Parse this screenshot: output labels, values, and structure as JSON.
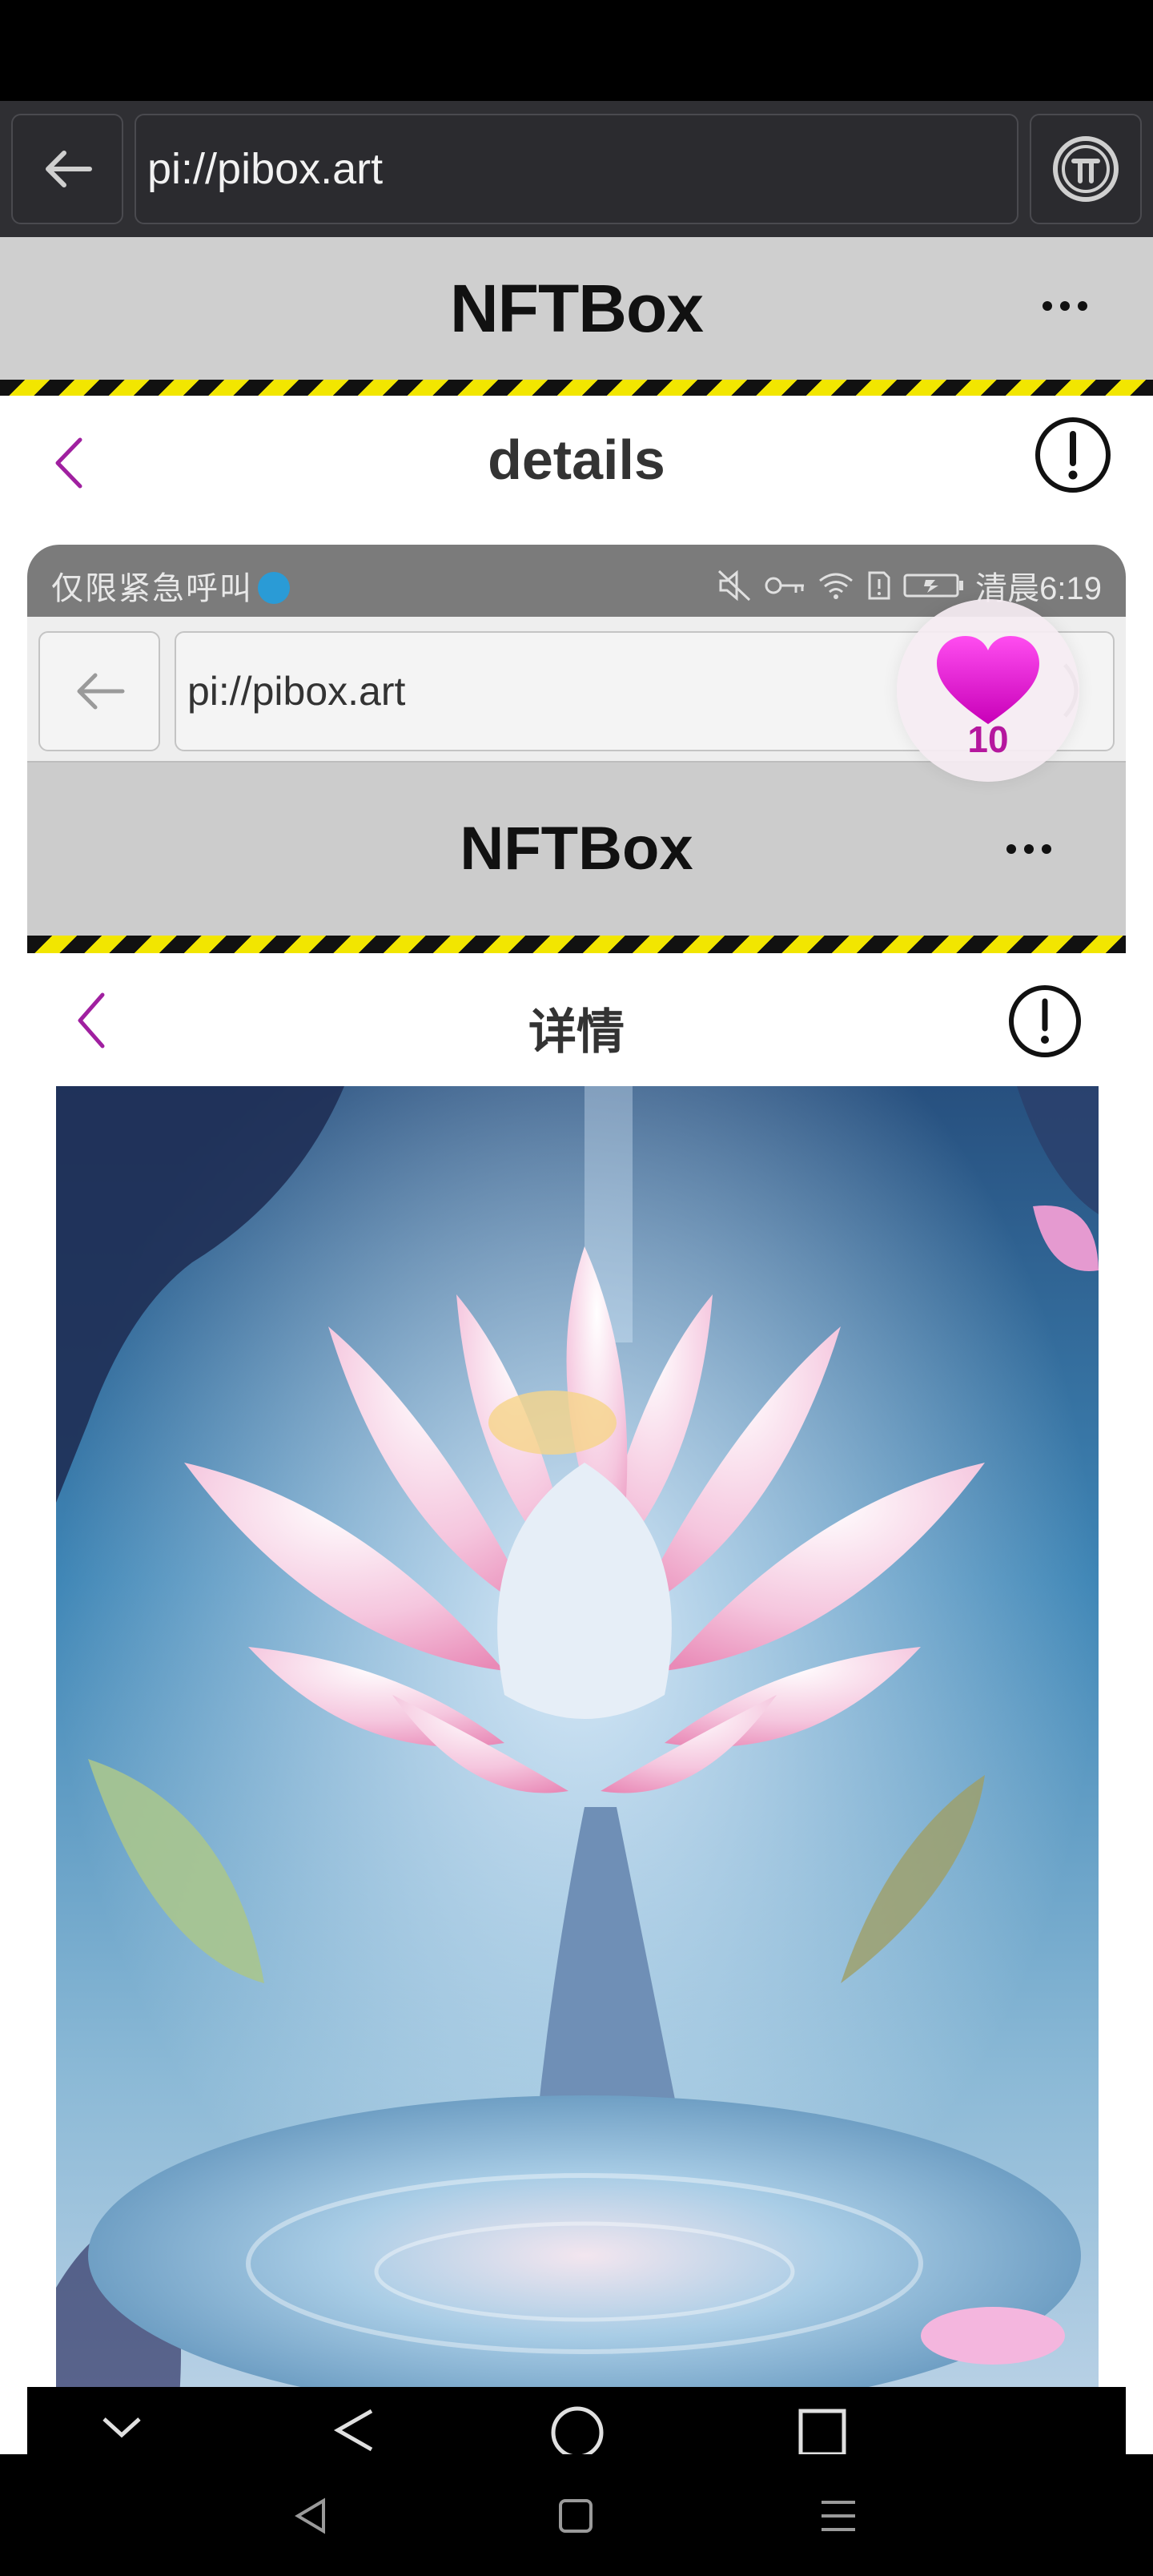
{
  "browser": {
    "url": "pi://pibox.art",
    "back_icon": "arrow-left-icon",
    "pi_icon": "pi-logo-icon"
  },
  "site": {
    "title": "NFTBox",
    "more_icon": "more-horizontal-icon"
  },
  "detail_page": {
    "title": "details",
    "back_icon": "chevron-left-icon",
    "info_icon": "info-circle-icon"
  },
  "embedded_screenshot": {
    "status_bar": {
      "left_text": "仅限紧急呼叫",
      "time": "清晨6:19"
    },
    "browser_url": "pi://pibox.art",
    "site_title": "NFTBox",
    "page_title": "详情",
    "artwork": "lotus-artwork-image"
  },
  "like_bubble": {
    "icon": "heart-icon",
    "count": "10"
  },
  "colors": {
    "accent": "#a020a0",
    "heart": "#e020d0",
    "hazard_yellow": "#f2e600",
    "header_gray": "#cfcfcf"
  }
}
